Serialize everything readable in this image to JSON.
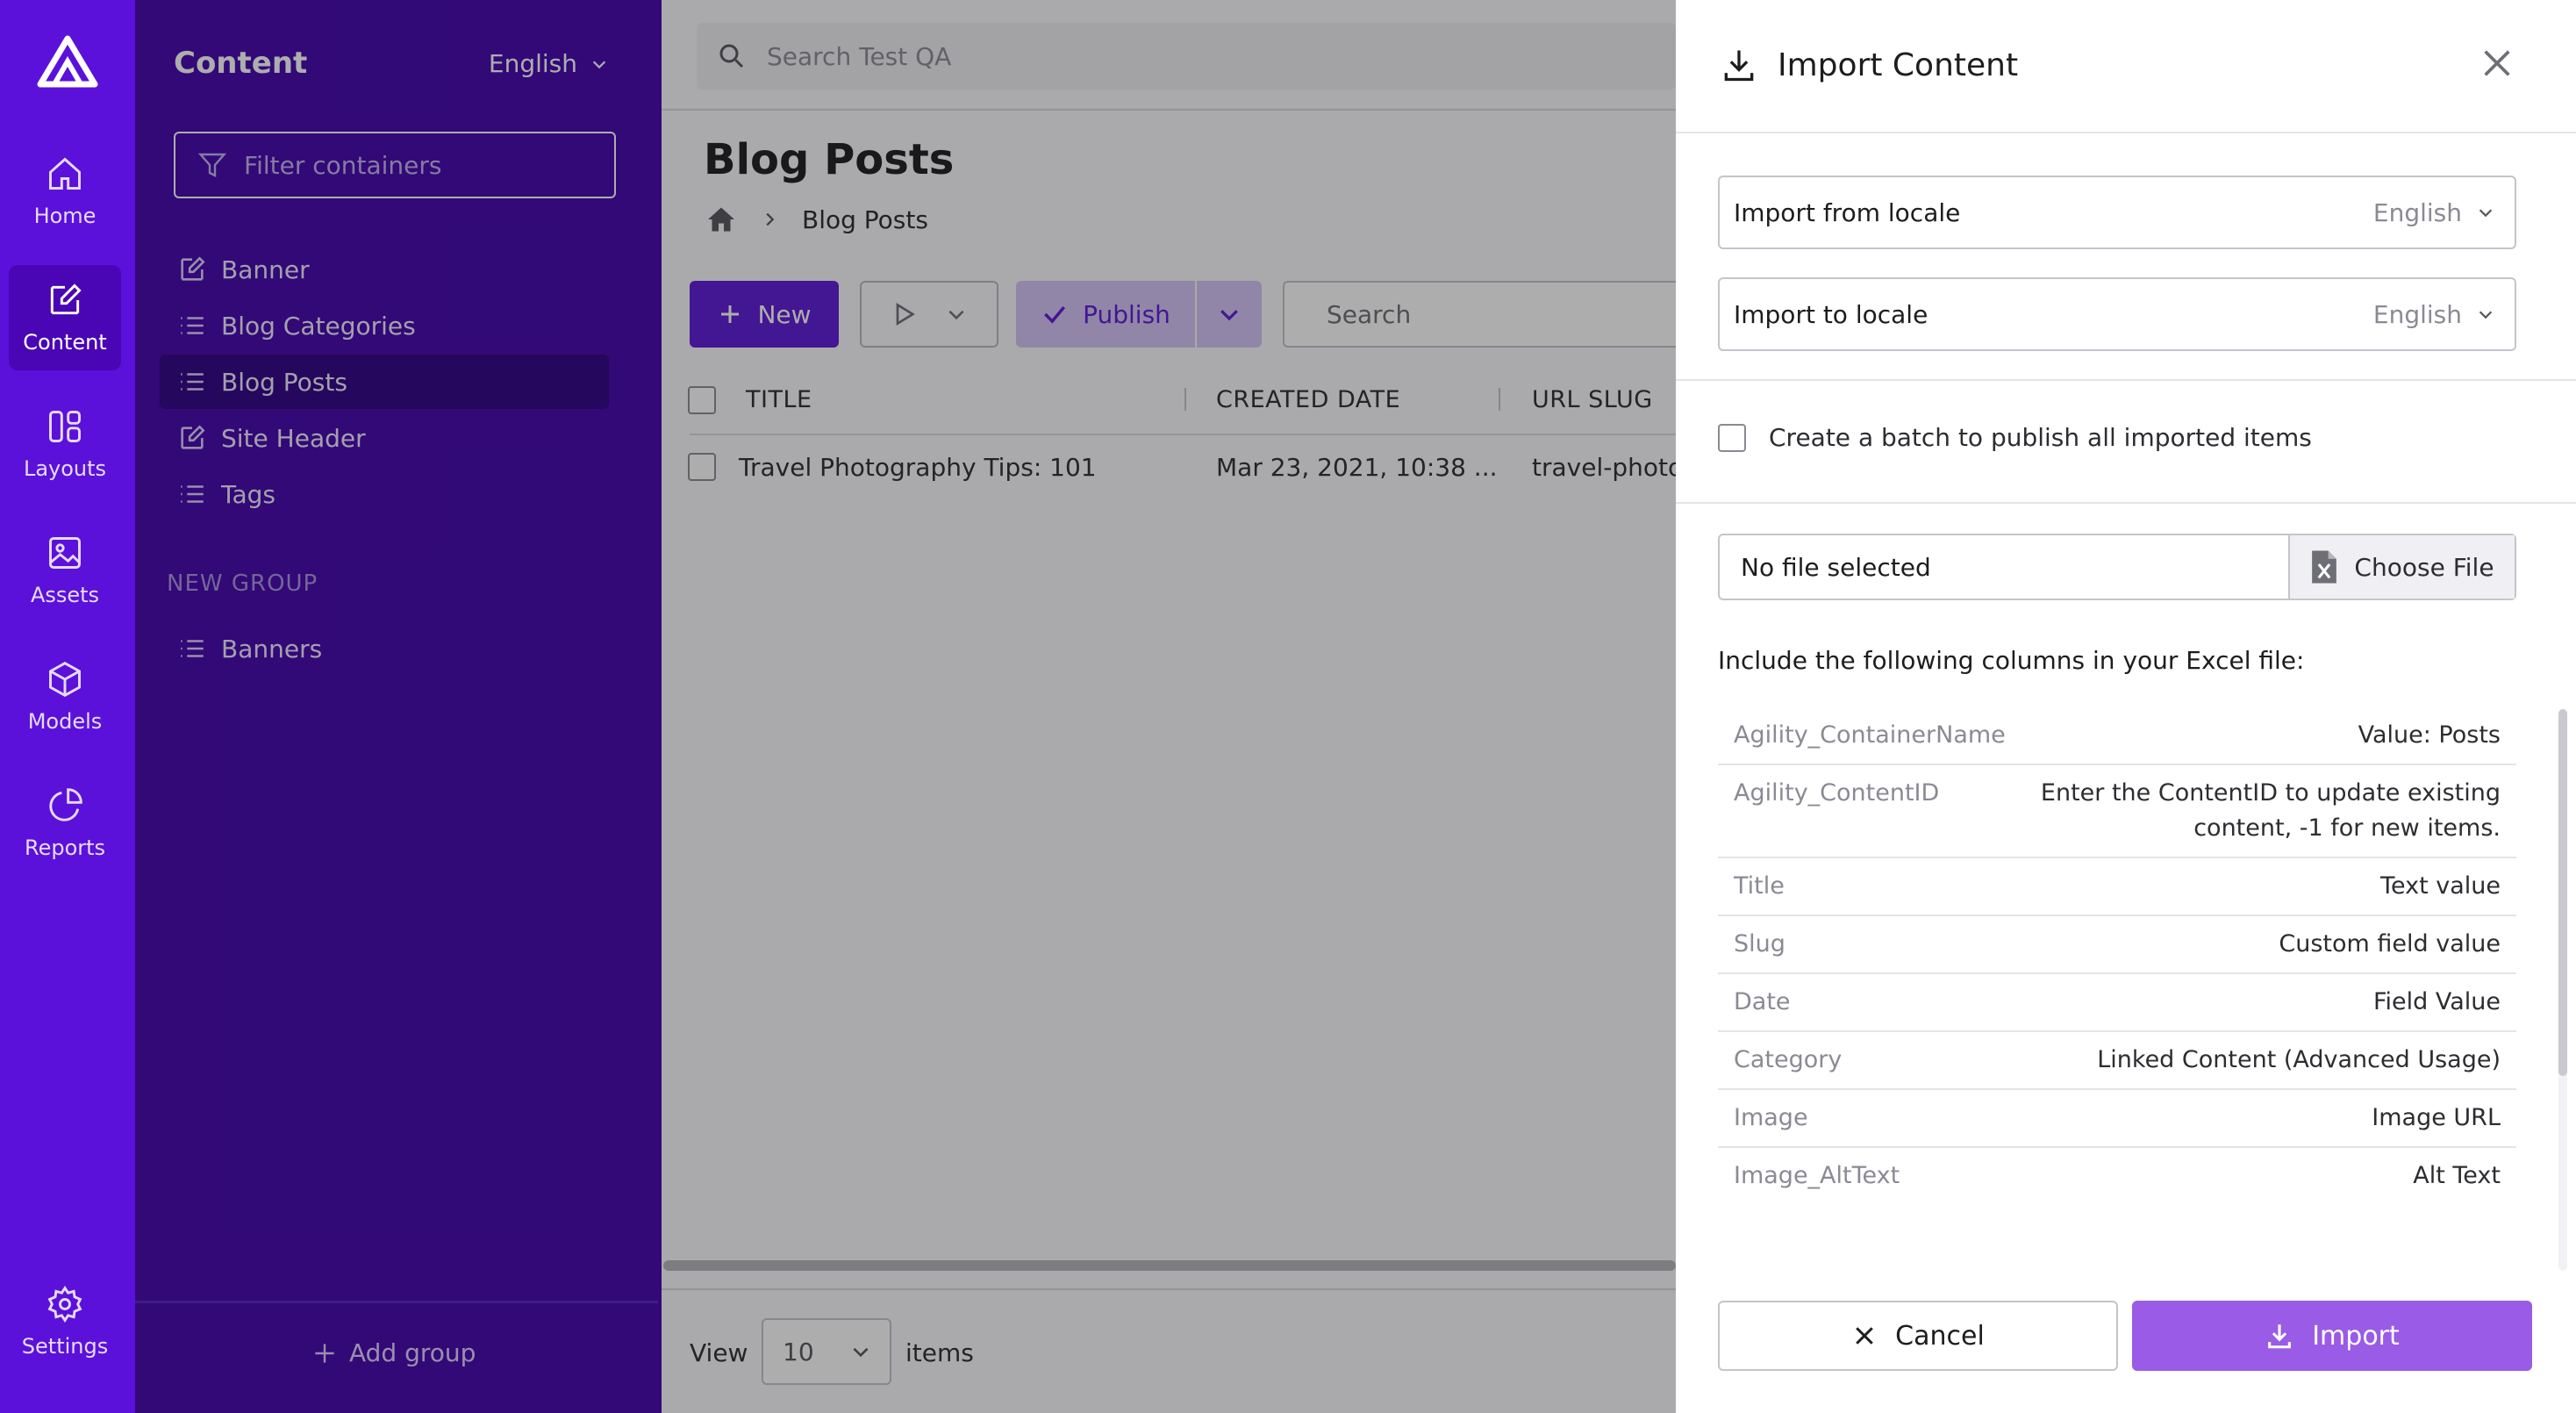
{
  "rail": {
    "items": [
      {
        "label": "Home",
        "icon": "home-icon"
      },
      {
        "label": "Content",
        "icon": "edit-icon",
        "active": true
      },
      {
        "label": "Layouts",
        "icon": "layouts-icon"
      },
      {
        "label": "Assets",
        "icon": "image-icon"
      },
      {
        "label": "Models",
        "icon": "cube-icon"
      },
      {
        "label": "Reports",
        "icon": "pie-chart-icon"
      },
      {
        "label": "Settings",
        "icon": "gear-icon"
      }
    ]
  },
  "sidebar": {
    "title": "Content",
    "locale": "English",
    "filter_placeholder": "Filter containers",
    "items": [
      {
        "label": "Banner",
        "icon": "edit-icon"
      },
      {
        "label": "Blog Categories",
        "icon": "list-icon"
      },
      {
        "label": "Blog Posts",
        "icon": "list-icon",
        "active": true
      },
      {
        "label": "Site Header",
        "icon": "edit-icon"
      },
      {
        "label": "Tags",
        "icon": "list-icon"
      }
    ],
    "group_label": "NEW GROUP",
    "group_items": [
      {
        "label": "Banners",
        "icon": "list-icon"
      }
    ],
    "add_group": "Add group"
  },
  "main": {
    "search_placeholder": "Search Test QA",
    "title": "Blog Posts",
    "breadcrumb": [
      "Blog Posts"
    ],
    "toolbar": {
      "new_label": "New",
      "publish_label": "Publish",
      "search_placeholder": "Search"
    },
    "table": {
      "columns": [
        "TITLE",
        "CREATED DATE",
        "URL SLUG"
      ],
      "rows": [
        [
          "Travel Photography Tips: 101",
          "Mar 23, 2021, 10:38 ...",
          "travel-photog"
        ]
      ]
    },
    "footer": {
      "view_label": "View",
      "page_size": "10",
      "items_label": "items"
    }
  },
  "panel": {
    "title": "Import Content",
    "import_from_label": "Import from locale",
    "import_from_value": "English",
    "import_to_label": "Import to locale",
    "import_to_value": "English",
    "batch_label": "Create a batch to publish all imported items",
    "file_name": "No file selected",
    "choose_file": "Choose File",
    "columns_heading": "Include the following columns in your Excel file:",
    "columns": [
      {
        "name": "Agility_ContainerName",
        "value": "Value: Posts"
      },
      {
        "name": "Agility_ContentID",
        "value": "Enter the ContentID to update existing content, -1 for new items."
      },
      {
        "name": "Title",
        "value": "Text value"
      },
      {
        "name": "Slug",
        "value": "Custom field value"
      },
      {
        "name": "Date",
        "value": "Field Value"
      },
      {
        "name": "Category",
        "value": "Linked Content (Advanced Usage)"
      },
      {
        "name": "Image",
        "value": "Image URL"
      },
      {
        "name": "Image_AltText",
        "value": "Alt Text"
      }
    ],
    "cancel_label": "Cancel",
    "import_label": "Import"
  },
  "colors": {
    "rail": "#5b11da",
    "sidebar": "#4204ad",
    "accent": "#5d17d8",
    "import_button": "#9a5be6"
  }
}
